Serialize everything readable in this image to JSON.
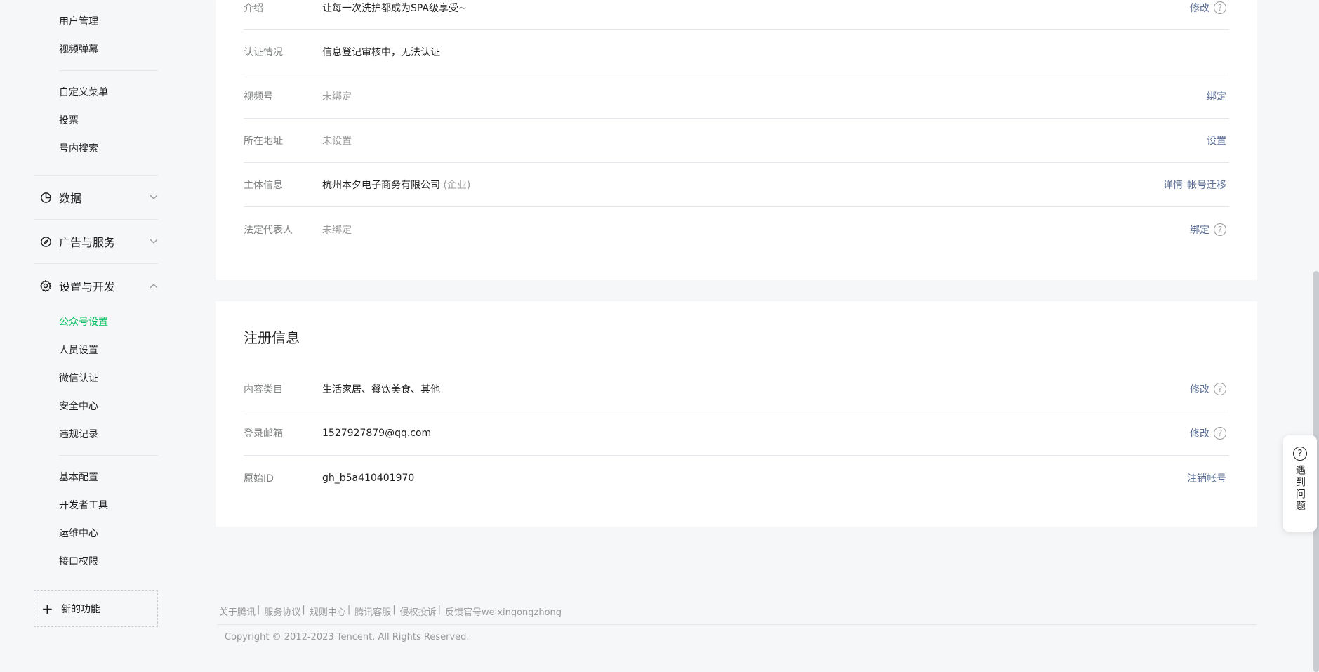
{
  "sidebar": {
    "items_top": [
      "用户管理",
      "视频弹幕",
      "自定义菜单",
      "投票",
      "号内搜索"
    ],
    "groups": {
      "data": "数据",
      "ads": "广告与服务",
      "settings": "设置与开发"
    },
    "items_settings": [
      "公众号设置",
      "人员设置",
      "微信认证",
      "安全中心",
      "违规记录",
      "基本配置",
      "开发者工具",
      "运维中心",
      "接口权限"
    ],
    "new_feature": "新的功能",
    "active_item": "公众号设置",
    "accent_color": "#07c160"
  },
  "account_info": {
    "rows": [
      {
        "label": "介绍",
        "value": "让每一次洗护都成为SPA级享受~",
        "action": "修改"
      },
      {
        "label": "认证情况",
        "value": "信息登记审核中，无法认证"
      },
      {
        "label": "视频号",
        "value": "未绑定",
        "action": "绑定"
      },
      {
        "label": "所在地址",
        "value": "未设置",
        "action": "设置"
      },
      {
        "label": "主体信息",
        "value": "杭州本夕电子商务有限公司",
        "value_note": "(企业)",
        "action": "详情",
        "action2": "帐号迁移"
      },
      {
        "label": "法定代表人",
        "value": "未绑定",
        "action": "绑定"
      }
    ]
  },
  "registration": {
    "title": "注册信息",
    "rows": [
      {
        "label": "内容类目",
        "value": "生活家居、餐饮美食、其他",
        "action": "修改"
      },
      {
        "label": "登录邮箱",
        "value": "1527927879@qq.com",
        "action": "修改"
      },
      {
        "label": "原始ID",
        "value": "gh_b5a410401970",
        "action": "注销帐号"
      }
    ]
  },
  "footer": {
    "links": [
      "关于腾讯",
      "服务协议",
      "规则中心",
      "腾讯客服",
      "侵权投诉",
      "反馈官号weixingongzhong"
    ],
    "separator": "|",
    "copyright": "Copyright © 2012-2023 Tencent. All Rights Reserved."
  },
  "help": {
    "icon": "question-icon",
    "label": "遇到问题"
  },
  "link_color": "#576b95"
}
